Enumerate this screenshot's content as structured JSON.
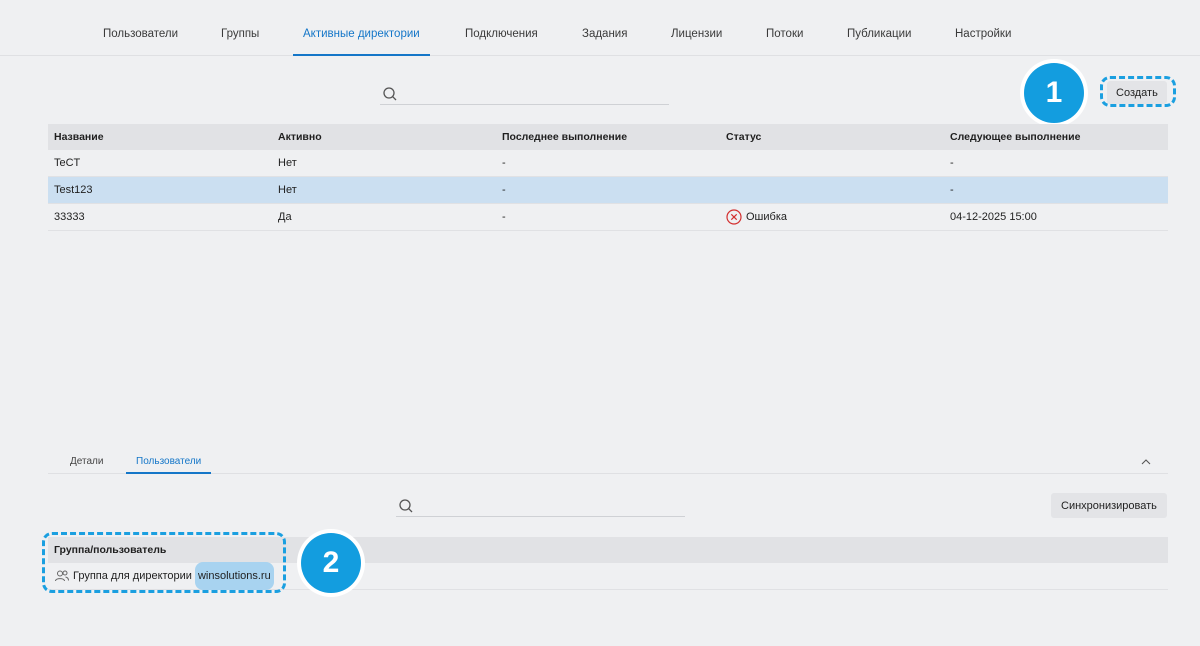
{
  "nav": {
    "tabs": [
      {
        "label": "Пользователи"
      },
      {
        "label": "Группы"
      },
      {
        "label": "Активные директории"
      },
      {
        "label": "Подключения"
      },
      {
        "label": "Задания"
      },
      {
        "label": "Лицензии"
      },
      {
        "label": "Потоки"
      },
      {
        "label": "Публикации"
      },
      {
        "label": "Настройки"
      }
    ],
    "active_index": 2
  },
  "toolbar": {
    "search_placeholder": "",
    "create_label": "Создать"
  },
  "table": {
    "columns": [
      "Название",
      "Активно",
      "Последнее выполнение",
      "Статус",
      "Следующее выполнение"
    ],
    "rows": [
      {
        "name": "TeCT",
        "active": "Нет",
        "last_run": "-",
        "status": "",
        "next_run": "-"
      },
      {
        "name": "Test123",
        "active": "Нет",
        "last_run": "-",
        "status": "",
        "next_run": "-"
      },
      {
        "name": "33333",
        "active": "Да",
        "last_run": "-",
        "status": "Ошибка",
        "next_run": "04-12-2025 15:00"
      }
    ],
    "selected_row_index": 1
  },
  "details": {
    "tabs": [
      {
        "label": "Детали"
      },
      {
        "label": "Пользователи"
      }
    ],
    "active_index": 1,
    "search_placeholder": "",
    "sync_label": "Синхронизировать",
    "column": "Группа/пользователь",
    "rows": [
      {
        "text": "Группа для директории",
        "domain": "winsolutions.ru"
      }
    ]
  },
  "annotations": {
    "badge1": "1",
    "badge2": "2"
  },
  "colors": {
    "accent": "#1476c8",
    "badge": "#139ddf",
    "error": "#d32f2f",
    "selected_row": "#cbdff1"
  }
}
